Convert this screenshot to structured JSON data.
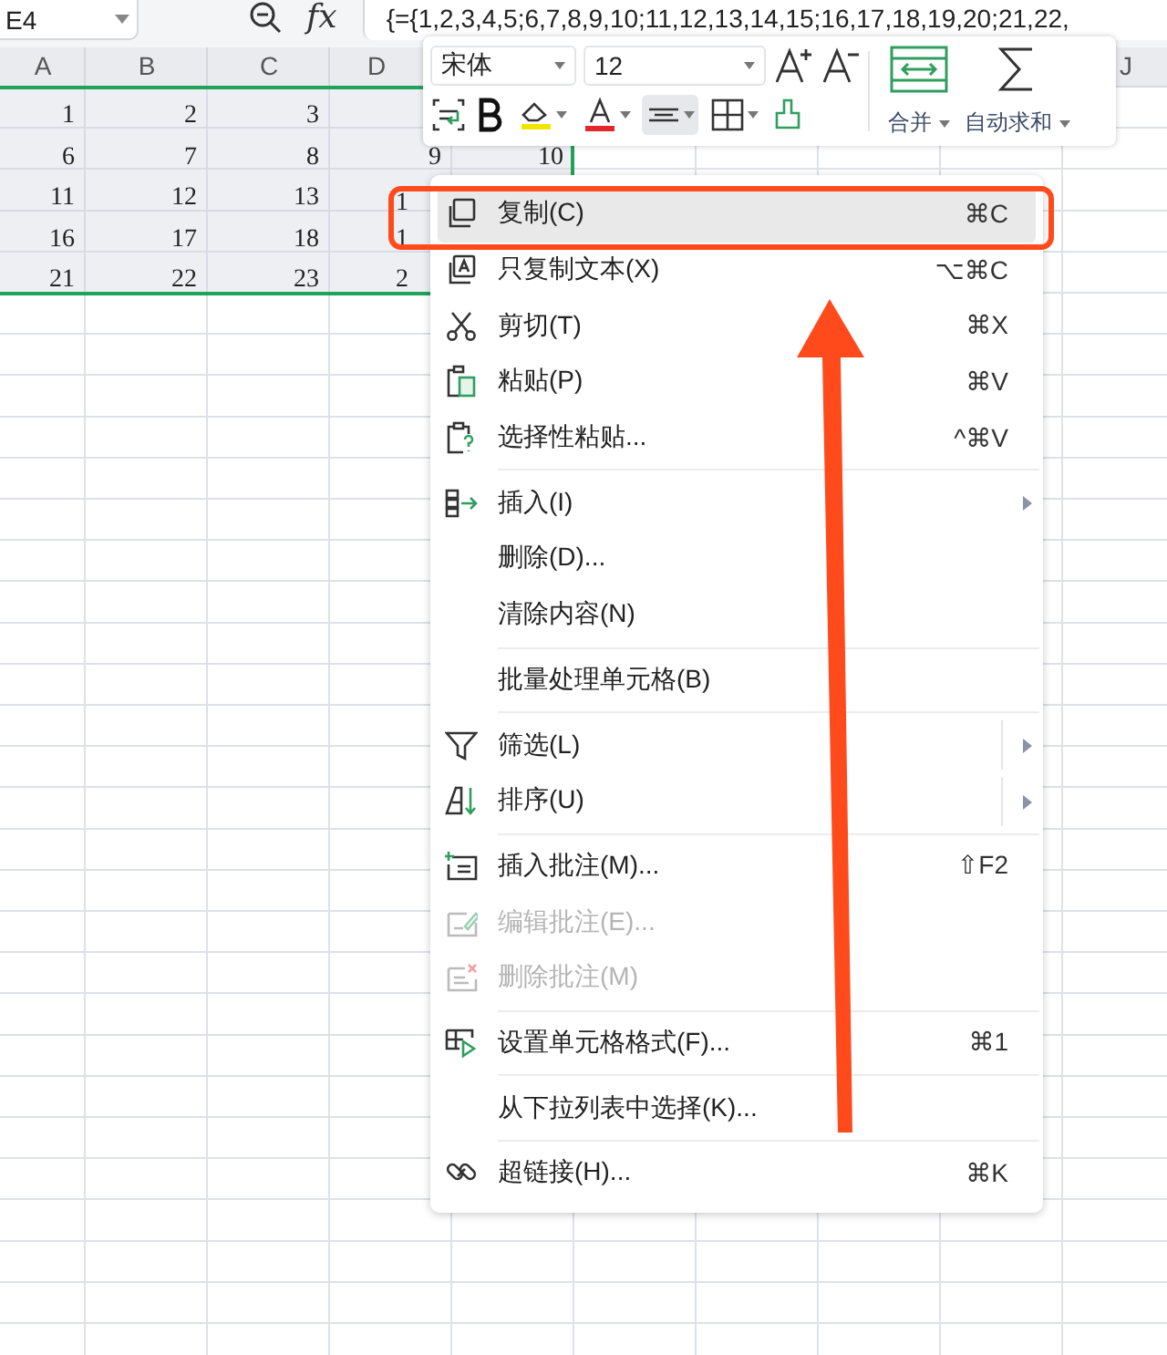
{
  "name_box": {
    "value": "E4"
  },
  "formula_bar": {
    "fx": "fx",
    "value": "{={1,2,3,4,5;6,7,8,9,10;11,12,13,14,15;16,17,18,19,20;21,22,"
  },
  "sheet": {
    "columns": [
      "A",
      "B",
      "C",
      "D"
    ],
    "edge_column": "J",
    "rows": [
      {
        "selected": true,
        "cells": [
          "1",
          "2",
          "3"
        ]
      },
      {
        "selected": true,
        "cells": [
          "6",
          "7",
          "8",
          "9",
          "10"
        ]
      },
      {
        "selected": true,
        "cells": [
          "11",
          "12",
          "13",
          "1"
        ]
      },
      {
        "selected": true,
        "cells": [
          "16",
          "17",
          "18",
          "1"
        ]
      },
      {
        "selected": true,
        "cells": [
          "21",
          "22",
          "23",
          "2"
        ]
      }
    ]
  },
  "toolbar": {
    "font": "宋体",
    "size": "12",
    "align_selected": true,
    "merge_label": "合并",
    "sum_label": "自动求和"
  },
  "menu": [
    {
      "kind": "item",
      "label": "复制(C)",
      "shortcut": "⌘C",
      "selected": true,
      "disabled": false
    },
    {
      "kind": "item",
      "label": "只复制文本(X)",
      "shortcut": "⌥⌘C",
      "selected": false,
      "disabled": false
    },
    {
      "kind": "item",
      "label": "剪切(T)",
      "shortcut": "⌘X",
      "selected": false,
      "disabled": false
    },
    {
      "kind": "item",
      "label": "粘贴(P)",
      "shortcut": "⌘V",
      "selected": false,
      "disabled": false
    },
    {
      "kind": "item",
      "label": "选择性粘贴...",
      "shortcut": "^⌘V",
      "selected": false,
      "disabled": false
    },
    {
      "kind": "separator"
    },
    {
      "kind": "item",
      "label": "插入(I)",
      "submenu": true,
      "selected": false,
      "disabled": false
    },
    {
      "kind": "item",
      "label": "删除(D)...",
      "selected": false,
      "disabled": false
    },
    {
      "kind": "item",
      "label": "清除内容(N)",
      "selected": false,
      "disabled": false
    },
    {
      "kind": "separator"
    },
    {
      "kind": "item",
      "label": "批量处理单元格(B)",
      "selected": false,
      "disabled": false
    },
    {
      "kind": "separator"
    },
    {
      "kind": "item",
      "label": "筛选(L)",
      "submenu": true,
      "split": true,
      "selected": false,
      "disabled": false
    },
    {
      "kind": "item",
      "label": "排序(U)",
      "submenu": true,
      "split": true,
      "selected": false,
      "disabled": false
    },
    {
      "kind": "separator"
    },
    {
      "kind": "item",
      "label": "插入批注(M)...",
      "shortcut": "⇧F2",
      "selected": false,
      "disabled": false
    },
    {
      "kind": "item",
      "label": "编辑批注(E)...",
      "selected": false,
      "disabled": true
    },
    {
      "kind": "item",
      "label": "删除批注(M)",
      "selected": false,
      "disabled": true
    },
    {
      "kind": "separator"
    },
    {
      "kind": "item",
      "label": "设置单元格格式(F)...",
      "shortcut": "⌘1",
      "selected": false,
      "disabled": false
    },
    {
      "kind": "separator"
    },
    {
      "kind": "item",
      "label": "从下拉列表中选择(K)...",
      "selected": false,
      "disabled": false
    },
    {
      "kind": "separator"
    },
    {
      "kind": "item",
      "label": "超链接(H)...",
      "shortcut": "⌘K",
      "selected": false,
      "disabled": false
    }
  ]
}
